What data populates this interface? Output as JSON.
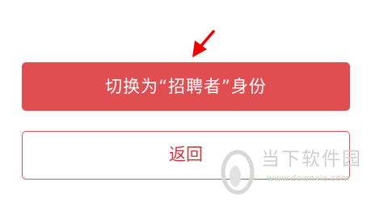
{
  "buttons": {
    "switch_role_label": "切换为“招聘者”身份",
    "back_label": "返回"
  },
  "watermark": {
    "name": "当下软件园",
    "url": "www.downxia.com"
  },
  "colors": {
    "primary": "#e04e51",
    "secondary_border": "#e05459",
    "secondary_text": "#d4373c",
    "arrow": "#ee0000",
    "watermark": "#cfcfcf"
  },
  "icons": {
    "annotation_arrow": "arrow-icon",
    "watermark_logo": "downxia-logo-icon"
  }
}
